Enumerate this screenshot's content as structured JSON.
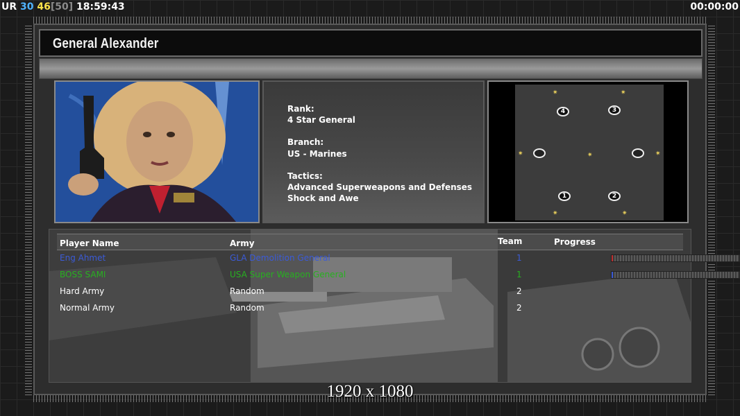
{
  "hud": {
    "label": "UR",
    "value_a": "30",
    "value_b": "46",
    "value_c": "[50]",
    "time": "18:59:43",
    "timer": "00:00:00"
  },
  "general": {
    "name": "General Alexander",
    "rank_label": "Rank:",
    "rank": "4 Star General",
    "branch_label": "Branch:",
    "branch": "US - Marines",
    "tactics_label": "Tactics:",
    "tactics_1": "Advanced Superweapons and Defenses",
    "tactics_2": "Shock and Awe"
  },
  "map": {
    "spawns": [
      "4",
      "3",
      "",
      "",
      "1",
      "2"
    ]
  },
  "players": {
    "headers": {
      "name": "Player Name",
      "army": "Army",
      "team": "Team",
      "progress": "Progress"
    },
    "rows": [
      {
        "name": "Eng Ahmet",
        "army": "GLA Demolition General",
        "team": "1",
        "color": "#3b5bd8",
        "progress": 0.01,
        "bar_color": "#c03030"
      },
      {
        "name": "BOSS SAMI",
        "army": "USA Super Weapon General",
        "team": "1",
        "color": "#28b020",
        "progress": 0.01,
        "bar_color": "#3a5ad8"
      },
      {
        "name": "Hard Army",
        "army": "Random",
        "team": "2",
        "color": "#ffffff"
      },
      {
        "name": "Normal Army",
        "army": "Random",
        "team": "2",
        "color": "#ffffff"
      }
    ]
  },
  "resolution": "1920 x 1080"
}
